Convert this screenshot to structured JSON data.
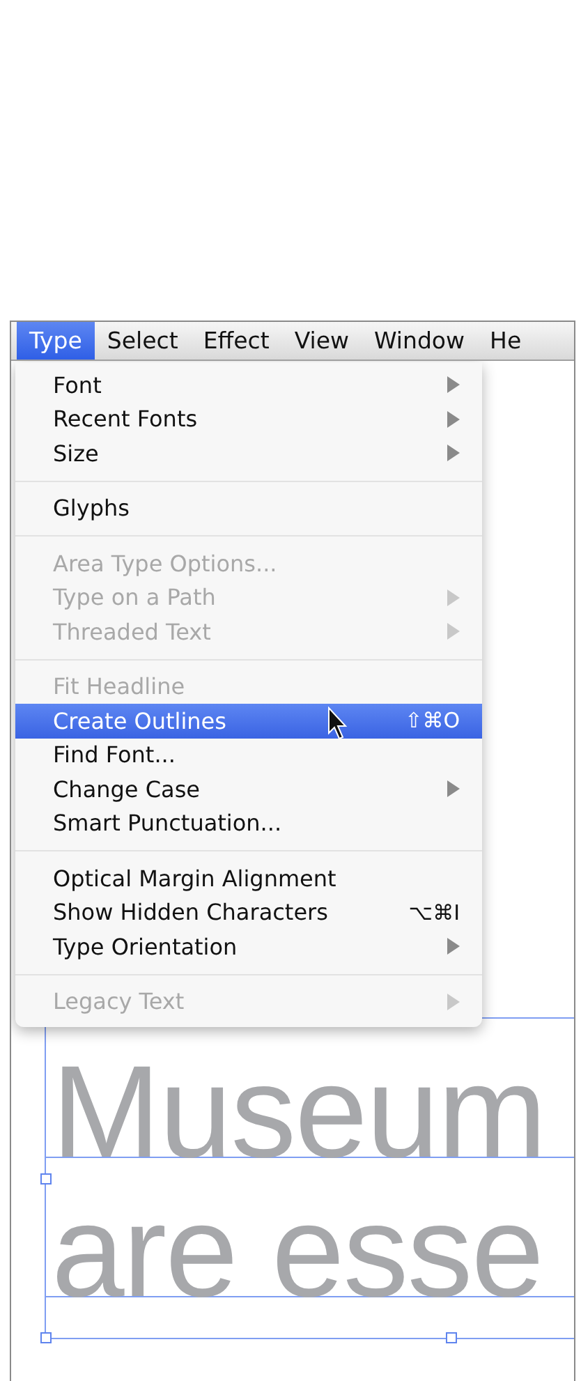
{
  "menu_bar": {
    "items": [
      {
        "label": "Type",
        "selected": true
      },
      {
        "label": "Select",
        "selected": false
      },
      {
        "label": "Effect",
        "selected": false
      },
      {
        "label": "View",
        "selected": false
      },
      {
        "label": "Window",
        "selected": false
      },
      {
        "label": "He",
        "selected": false
      }
    ]
  },
  "menu": {
    "groups": [
      [
        {
          "label": "Font",
          "disabled": false,
          "selected": false,
          "submenu": true
        },
        {
          "label": "Recent Fonts",
          "disabled": false,
          "selected": false,
          "submenu": true
        },
        {
          "label": "Size",
          "disabled": false,
          "selected": false,
          "submenu": true
        }
      ],
      [
        {
          "label": "Glyphs",
          "disabled": false,
          "selected": false,
          "submenu": false
        }
      ],
      [
        {
          "label": "Area Type Options...",
          "disabled": true,
          "selected": false,
          "submenu": false
        },
        {
          "label": "Type on a Path",
          "disabled": true,
          "selected": false,
          "submenu": true
        },
        {
          "label": "Threaded Text",
          "disabled": true,
          "selected": false,
          "submenu": true
        }
      ],
      [
        {
          "label": "Fit Headline",
          "disabled": true,
          "selected": false,
          "submenu": false
        },
        {
          "label": "Create Outlines",
          "disabled": false,
          "selected": true,
          "submenu": false,
          "shortcut": "⇧⌘O"
        },
        {
          "label": "Find Font...",
          "disabled": false,
          "selected": false,
          "submenu": false
        },
        {
          "label": "Change Case",
          "disabled": false,
          "selected": false,
          "submenu": true
        },
        {
          "label": "Smart Punctuation...",
          "disabled": false,
          "selected": false,
          "submenu": false
        }
      ],
      [
        {
          "label": "Optical Margin Alignment",
          "disabled": false,
          "selected": false,
          "submenu": false
        },
        {
          "label": "Show Hidden Characters",
          "disabled": false,
          "selected": false,
          "submenu": false,
          "shortcut": "⌥⌘I"
        },
        {
          "label": "Type Orientation",
          "disabled": false,
          "selected": false,
          "submenu": true
        }
      ],
      [
        {
          "label": "Legacy Text",
          "disabled": true,
          "selected": false,
          "submenu": true
        }
      ]
    ]
  },
  "canvas": {
    "lines": [
      "Museum",
      "are esse"
    ]
  }
}
